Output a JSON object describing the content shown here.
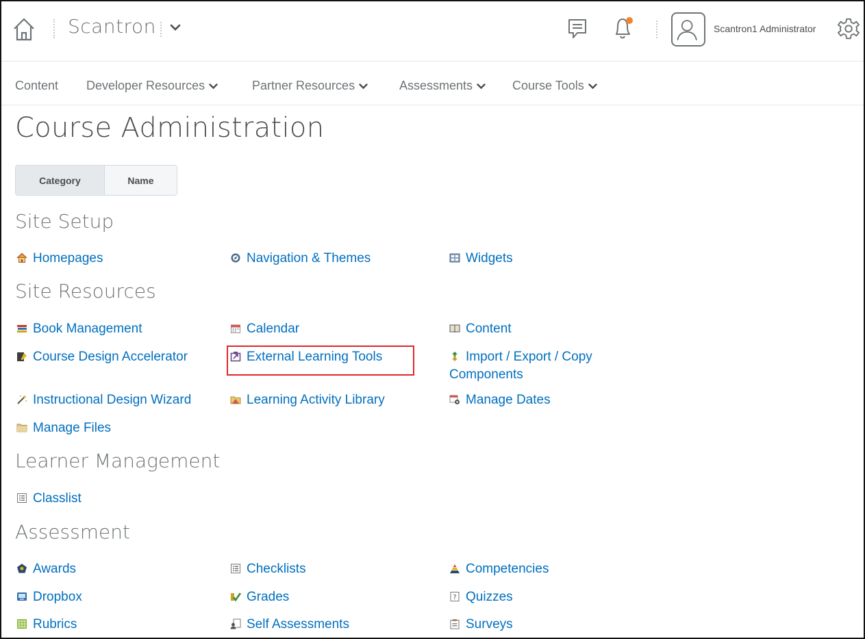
{
  "header": {
    "org_name": "Scantron",
    "user_name": "Scantron1 Administrator",
    "notification_dot_color": "#f3842e",
    "icons": [
      "home-icon",
      "chevron-down-icon",
      "message-icon",
      "bell-icon",
      "avatar-icon",
      "gear-icon"
    ]
  },
  "nav": {
    "items": [
      {
        "label": "Content",
        "has_dropdown": false
      },
      {
        "label": "Developer Resources",
        "has_dropdown": true
      },
      {
        "label": "Partner Resources",
        "has_dropdown": true
      },
      {
        "label": "Assessments",
        "has_dropdown": true
      },
      {
        "label": "Course Tools",
        "has_dropdown": true
      }
    ]
  },
  "page": {
    "title": "Course Administration",
    "view_toggle": {
      "options": [
        "Category",
        "Name"
      ],
      "selected": "Category"
    },
    "link_color": "#006fbf",
    "highlight_color": "#e0262b"
  },
  "sections": [
    {
      "title": "Site Setup",
      "tools": [
        {
          "label": "Homepages",
          "icon": "home-icon"
        },
        {
          "label": "Navigation & Themes",
          "icon": "compass-icon"
        },
        {
          "label": "Widgets",
          "icon": "widgets-icon"
        }
      ]
    },
    {
      "title": "Site Resources",
      "tools": [
        {
          "label": "Book Management",
          "icon": "books-icon"
        },
        {
          "label": "Calendar",
          "icon": "calendar-icon"
        },
        {
          "label": "Content",
          "icon": "open-book-icon"
        },
        {
          "label": "Course Design Accelerator",
          "icon": "accelerator-icon"
        },
        {
          "label": "External Learning Tools",
          "icon": "external-tool-icon"
        },
        {
          "label": "Import / Export / Copy",
          "label_line2": "Components",
          "icon": "import-export-icon"
        },
        {
          "label": "Instructional Design Wizard",
          "icon": "wand-icon"
        },
        {
          "label": "Learning Activity Library",
          "icon": "library-icon"
        },
        {
          "label": "Manage Dates",
          "icon": "calendar-gear-icon"
        },
        {
          "label": "Manage Files",
          "icon": "folder-icon"
        }
      ]
    },
    {
      "title": "Learner Management",
      "tools": [
        {
          "label": "Classlist",
          "icon": "list-icon"
        }
      ]
    },
    {
      "title": "Assessment",
      "tools": [
        {
          "label": "Awards",
          "icon": "award-icon"
        },
        {
          "label": "Checklists",
          "icon": "checklist-icon"
        },
        {
          "label": "Competencies",
          "icon": "pyramid-icon"
        },
        {
          "label": "Dropbox",
          "icon": "dropbox-icon"
        },
        {
          "label": "Grades",
          "icon": "grades-icon"
        },
        {
          "label": "Quizzes",
          "icon": "quiz-icon"
        },
        {
          "label": "Rubrics",
          "icon": "rubric-icon"
        },
        {
          "label": "Self Assessments",
          "icon": "self-assessment-icon"
        },
        {
          "label": "Surveys",
          "icon": "survey-icon"
        }
      ]
    }
  ]
}
